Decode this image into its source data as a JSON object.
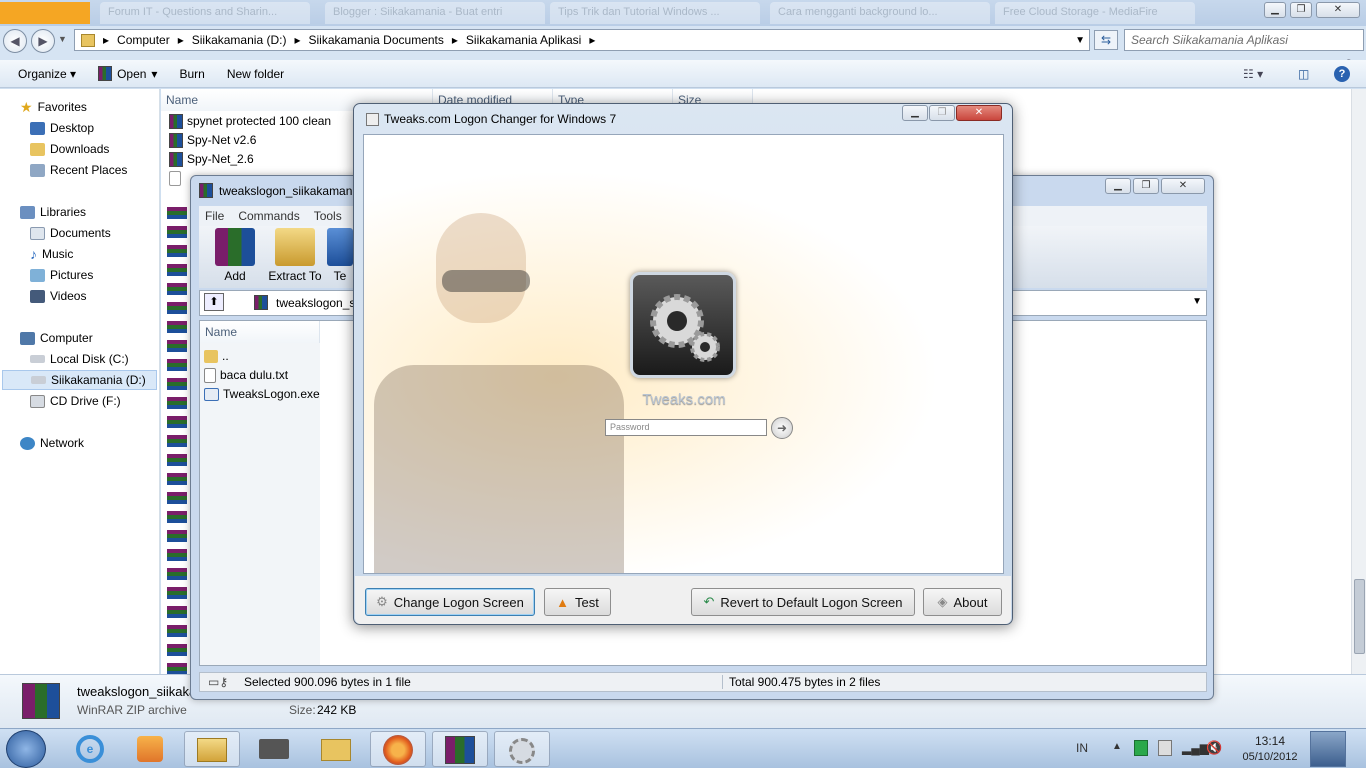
{
  "browser_tabs": [
    "Forum IT - Questions and Sharin...",
    "Blogger : Siikakamania - Buat entri",
    "Tips Trik dan Tutorial Windows ...",
    "Cara mengganti background lo...",
    "Free Cloud Storage - MediaFire"
  ],
  "explorer": {
    "breadcrumb": [
      "Computer",
      "Siikakamania (D:)",
      "Siikakamania Documents",
      "Siikakamania Aplikasi"
    ],
    "search_placeholder": "Search Siikakamania Aplikasi",
    "commands": {
      "organize": "Organize",
      "open": "Open",
      "burn": "Burn",
      "new_folder": "New folder"
    },
    "nav": {
      "favorites": "Favorites",
      "desktop": "Desktop",
      "downloads": "Downloads",
      "recent_places": "Recent Places",
      "libraries": "Libraries",
      "documents": "Documents",
      "music": "Music",
      "pictures": "Pictures",
      "videos": "Videos",
      "computer": "Computer",
      "local_disk": "Local Disk (C:)",
      "siikakamania": "Siikakamania (D:)",
      "cd_drive": "CD Drive (F:)",
      "network": "Network"
    },
    "columns": {
      "name": "Name",
      "date_modified": "Date modified",
      "type": "Type",
      "size": "Size"
    },
    "files": [
      "spynet protected 100 clean",
      "Spy-Net v2.6",
      "Spy-Net_2.6"
    ],
    "details": {
      "filename": "tweakslogon_siikaka",
      "filetype": "WinRAR ZIP archive",
      "size_label": "Size:",
      "size_value": "242 KB"
    }
  },
  "winrar": {
    "title": "tweakslogon_siikakamani",
    "menu": {
      "file": "File",
      "commands": "Commands",
      "tools": "Tools"
    },
    "toolbar": {
      "add": "Add",
      "extract_to": "Extract To",
      "test": "Te"
    },
    "path": "tweakslogon_si",
    "column_name": "Name",
    "files": [
      "..",
      "baca dulu.txt",
      "TweaksLogon.exe"
    ],
    "status_left": "Selected 900.096 bytes in 1 file",
    "status_right": "Total 900.475 bytes in 2 files"
  },
  "dialog": {
    "title": "Tweaks.com Logon Changer for Windows 7",
    "brand": "Tweaks.com",
    "password_placeholder": "Password",
    "buttons": {
      "change": "Change Logon Screen",
      "test": "Test",
      "revert": "Revert to Default Logon Screen",
      "about": "About"
    }
  },
  "taskbar": {
    "lang": "IN",
    "time": "13:14",
    "date": "05/10/2012"
  },
  "colors": {
    "accent": "#3a6ea5",
    "taskbar": "#b9cde6",
    "dialog_border": "#4f5f74",
    "close_button": "#c9463d"
  }
}
